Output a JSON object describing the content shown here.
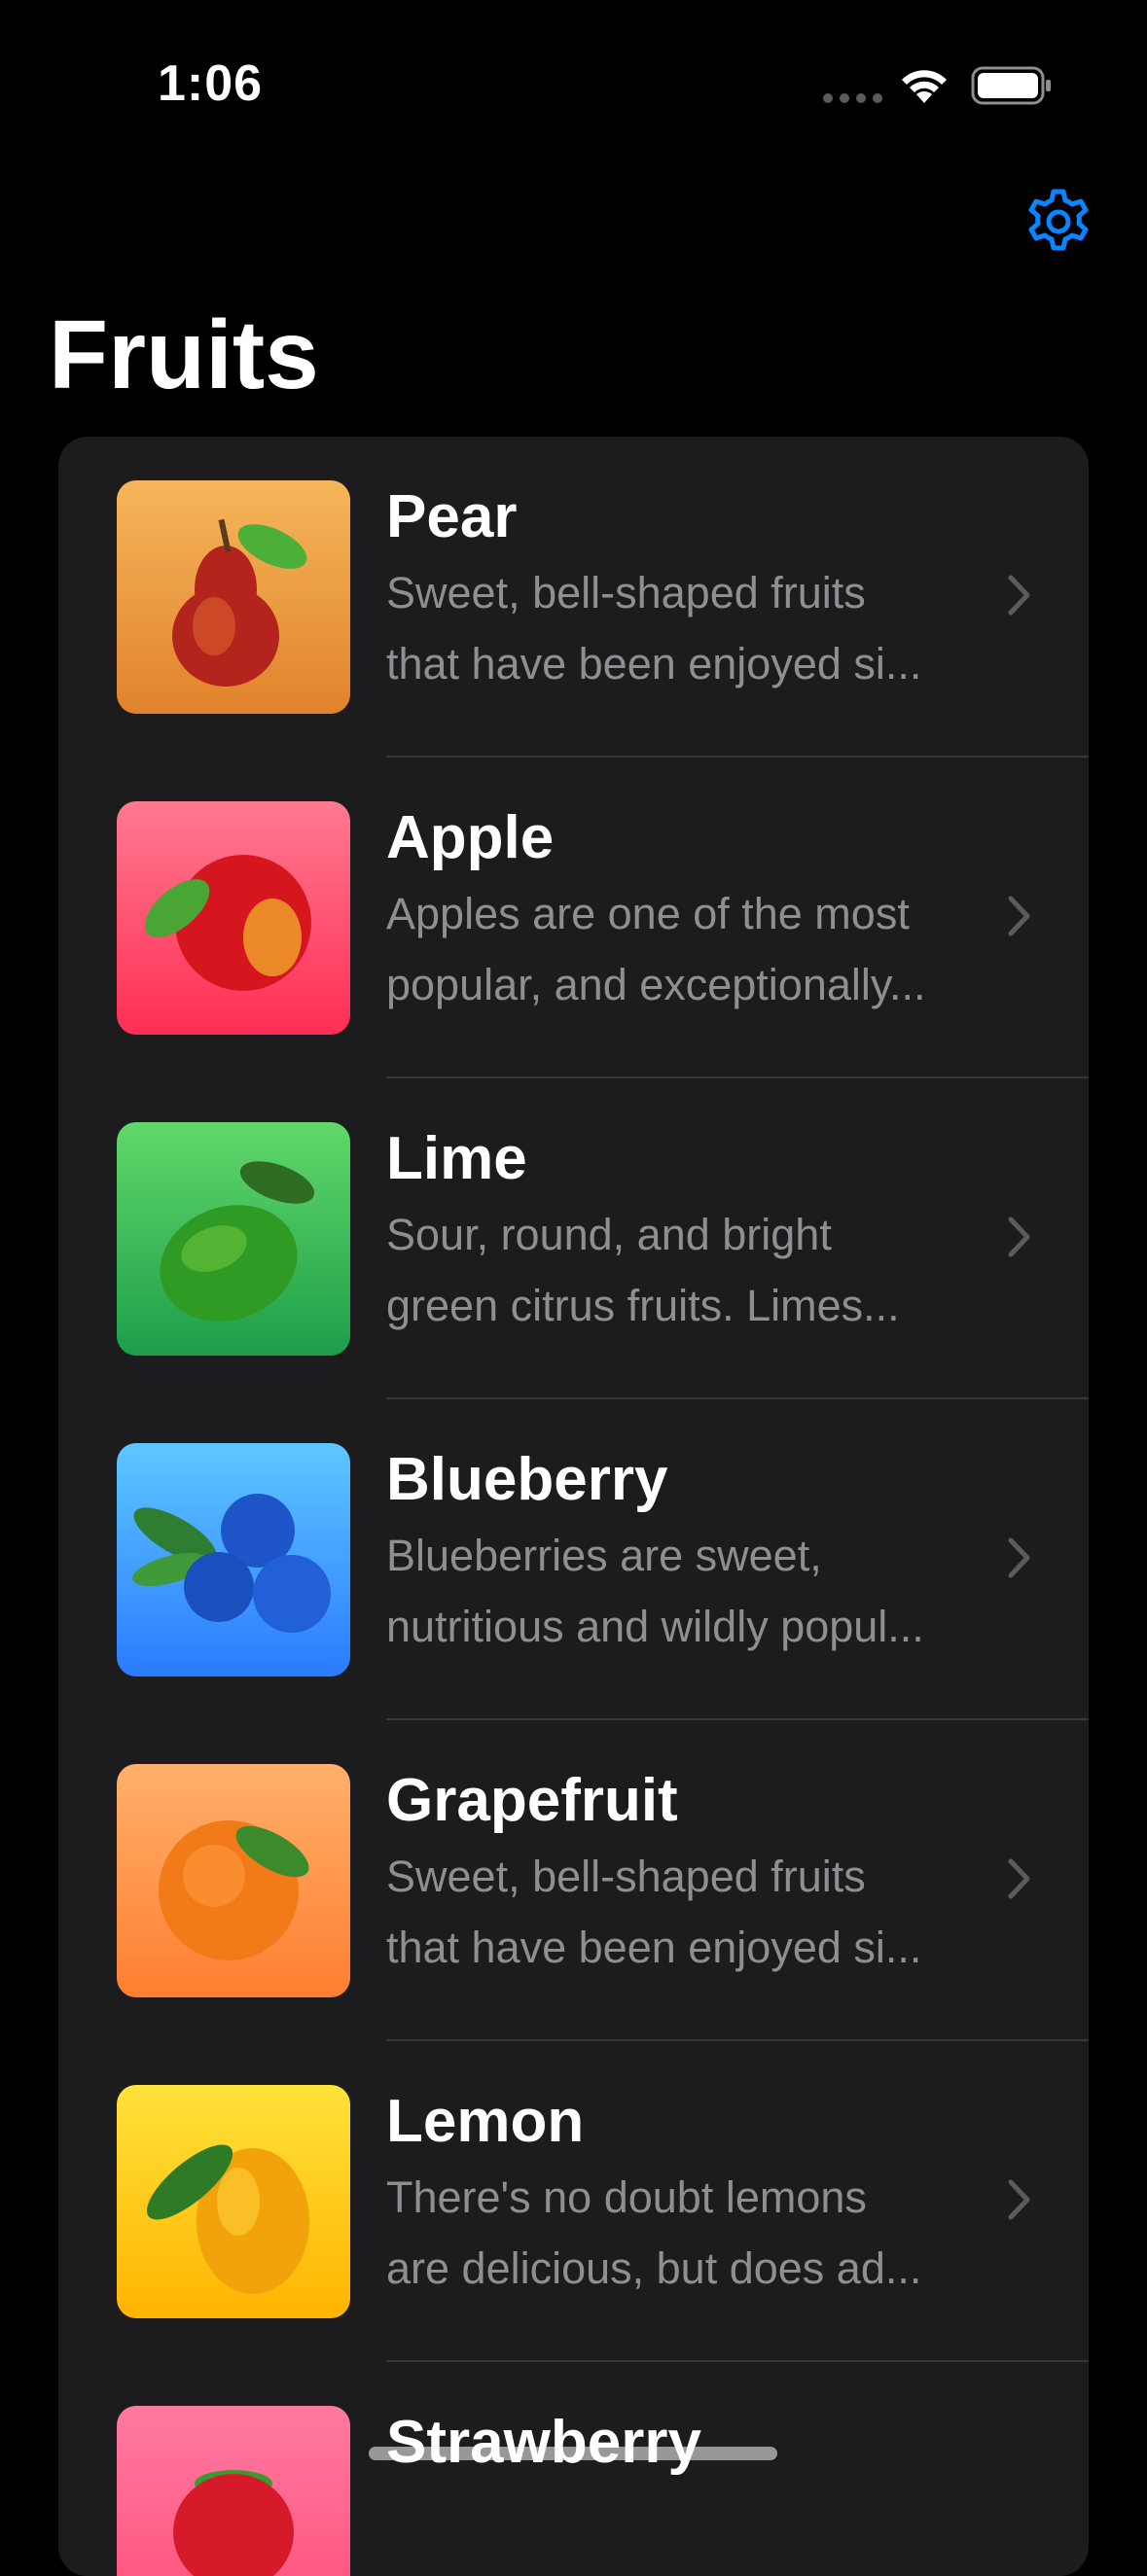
{
  "status_bar": {
    "time": "1:06",
    "wifi_icon": "wifi-icon",
    "battery_icon": "battery-icon",
    "signal_icon": "cellular-dots-icon"
  },
  "nav": {
    "title": "Fruits",
    "settings_icon": "gear-icon",
    "accent_color": "#0a84ff"
  },
  "fruits": [
    {
      "name": "Pear",
      "desc_line1": "Sweet, bell-shaped fruits",
      "desc_line2": "that have been enjoyed si...",
      "icon": "pear-image",
      "gradient": [
        "#f6b65a",
        "#e0832b"
      ]
    },
    {
      "name": "Apple",
      "desc_line1": "Apples are one of the most",
      "desc_line2": "popular, and exceptionally...",
      "icon": "apple-image",
      "gradient": [
        "#ff7a8f",
        "#ff2e55"
      ]
    },
    {
      "name": "Lime",
      "desc_line1": "Sour, round, and bright",
      "desc_line2": "green citrus fruits. Limes...",
      "icon": "lime-image",
      "gradient": [
        "#61d86a",
        "#1e9e4a"
      ]
    },
    {
      "name": "Blueberry",
      "desc_line1": "Blueberries are sweet,",
      "desc_line2": "nutritious and wildly popul...",
      "icon": "blueberry-image",
      "gradient": [
        "#5ec7ff",
        "#2b7bff"
      ]
    },
    {
      "name": "Grapefruit",
      "desc_line1": "Sweet, bell-shaped fruits",
      "desc_line2": "that have been enjoyed si...",
      "icon": "grapefruit-image",
      "gradient": [
        "#ffb06b",
        "#ff7f30"
      ]
    },
    {
      "name": "Lemon",
      "desc_line1": "There's no doubt lemons",
      "desc_line2": "are delicious, but does ad...",
      "icon": "lemon-image",
      "gradient": [
        "#ffe23a",
        "#ffb400"
      ]
    },
    {
      "name": "Strawberry",
      "desc_line1": "",
      "desc_line2": "",
      "icon": "strawberry-image",
      "gradient": [
        "#ff7aa0",
        "#ff4d7a"
      ]
    }
  ]
}
